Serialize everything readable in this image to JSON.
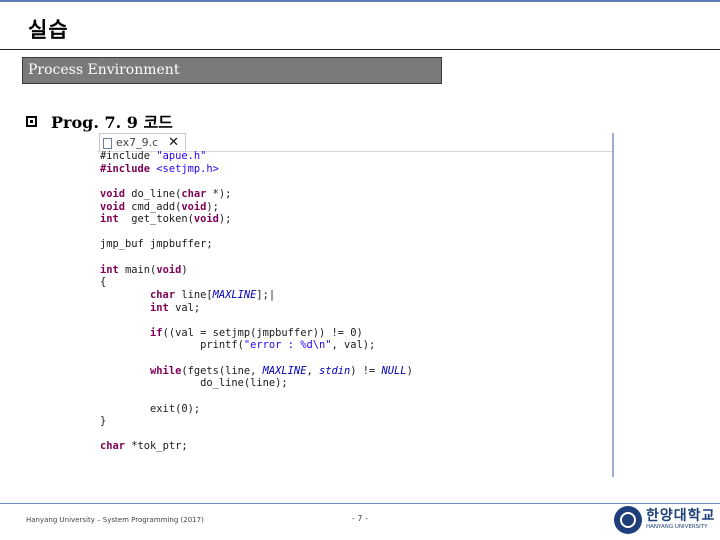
{
  "slide": {
    "title": "실습",
    "section_bar": "Process Environment",
    "bullet_text": "Prog. 7. 9 코드"
  },
  "editor": {
    "tab_label": "ex7_9.c",
    "tab_close": "✕",
    "code_lines": [
      "#include \"apue.h\"",
      "#include <setjmp.h>",
      "",
      "void do_line(char *);",
      "void cmd_add(void);",
      "int  get_token(void);",
      "",
      "jmp_buf jmpbuffer;",
      "",
      "int main(void)",
      "{",
      "        char line[MAXLINE];|",
      "        int val;",
      "",
      "        if((val = setjmp(jmpbuffer)) != 0)",
      "                printf(\"error : %d\\n\", val);",
      "",
      "        while(fgets(line, MAXLINE, stdin) != NULL)",
      "                do_line(line);",
      "",
      "        exit(0);",
      "}",
      "",
      "char *tok_ptr;"
    ]
  },
  "footer": {
    "left_text": "Hanyang University – System Programming (2017)",
    "page_number": "- 7 -",
    "logo_korean": "한양대학교",
    "logo_english": "HANYANG UNIVERSITY"
  },
  "colors": {
    "accent_rule": "#5b7fb5",
    "section_bar_bg": "#7a7a7a",
    "keyword": "#7f0055",
    "string": "#2a00ff",
    "logo_blue": "#1e3f7a"
  }
}
